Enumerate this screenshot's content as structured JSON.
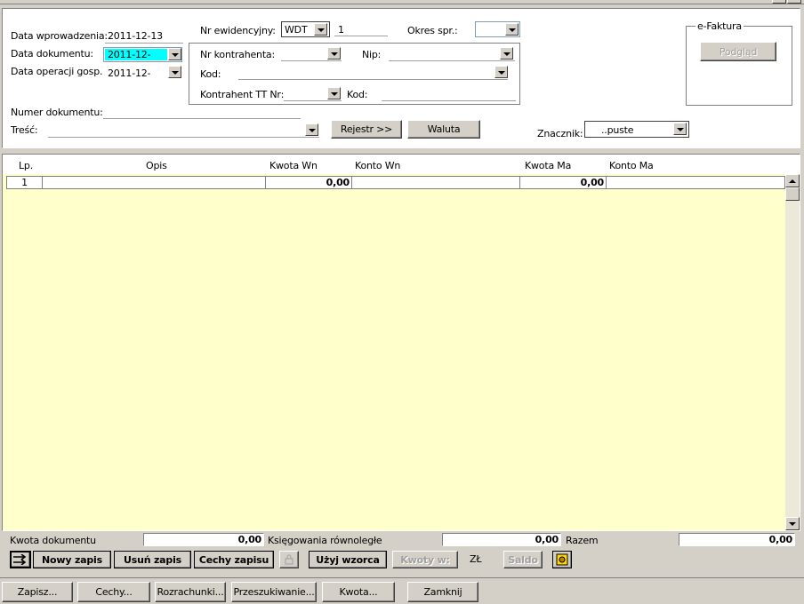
{
  "header": {
    "data_wprowadzenia_label": "Data wprowadzenia:",
    "data_wprowadzenia_value": "2011-12-13",
    "data_dokumentu_label": "Data dokumentu:",
    "data_dokumentu_value": "2011-12-",
    "data_operacji_label": "Data operacji gosp.:",
    "data_operacji_value": "2011-12-",
    "nr_ewidencyjny_label": "Nr ewidencyjny:",
    "nr_ewidencyjny_prefix": "WDT",
    "nr_ewidencyjny_value": "1",
    "okres_label": "Okres spr.:",
    "okres_value": "",
    "nr_kontrahenta_label": "Nr kontrahenta:",
    "nr_kontrahenta_value": "",
    "nip_label": "Nip:",
    "nip_value": "",
    "kod_label": "Kod:",
    "kod_value": "",
    "kontrahent_tt_label": "Kontrahent TT Nr:",
    "kontrahent_tt_value": "",
    "kod2_label": "Kod:",
    "kod2_value": "",
    "numer_dokumentu_label": "Numer dokumentu:",
    "numer_dokumentu_value": "",
    "tresc_label": "Treść:",
    "tresc_value": "",
    "rejestr_button": "Rejestr >>",
    "waluta_button": "Waluta",
    "znacznik_label": "Znacznik:",
    "znacznik_value": "..puste",
    "efaktura_label": "e-Faktura",
    "podglad_button": "Podgląd"
  },
  "grid": {
    "columns": [
      "Lp.",
      "Opis",
      "Kwota  Wn",
      "Konto  Wn",
      "Kwota Ma",
      "Konto Ma"
    ],
    "rows": [
      {
        "lp": "1",
        "opis": "",
        "kwota_wn": "0,00",
        "konto_wn": "",
        "kwota_ma": "0,00",
        "konto_ma": ""
      }
    ]
  },
  "totals": {
    "kwota_dokumentu_label": "Kwota dokumentu",
    "kwota_dokumentu_value": "0,00",
    "ksiegowania_label": "Księgowania równoległe",
    "ksiegowania_value": "0,00",
    "razem_label": "Razem",
    "razem_value": "0,00"
  },
  "toolbar": {
    "nowy_zapis": "Nowy zapis",
    "usun_zapis": "Usuń zapis",
    "cechy_zapisu": "Cechy zapisu",
    "uzyj_wzorca": "Użyj wzorca",
    "kwoty_w": "Kwoty w:",
    "currency": "ZŁ",
    "saldo": "Saldo"
  },
  "bottom": {
    "zapisz": "Zapisz...",
    "cechy": "Cechy...",
    "rozrachunki": "Rozrachunki...",
    "przeszukiwanie": "Przeszukiwanie...",
    "kwota": "Kwota...",
    "zamknij": "Zamknij"
  },
  "colors": {
    "highlight": "#00ffff",
    "grid_background": "#ffffcc",
    "window_background": "#d4d0c8"
  }
}
